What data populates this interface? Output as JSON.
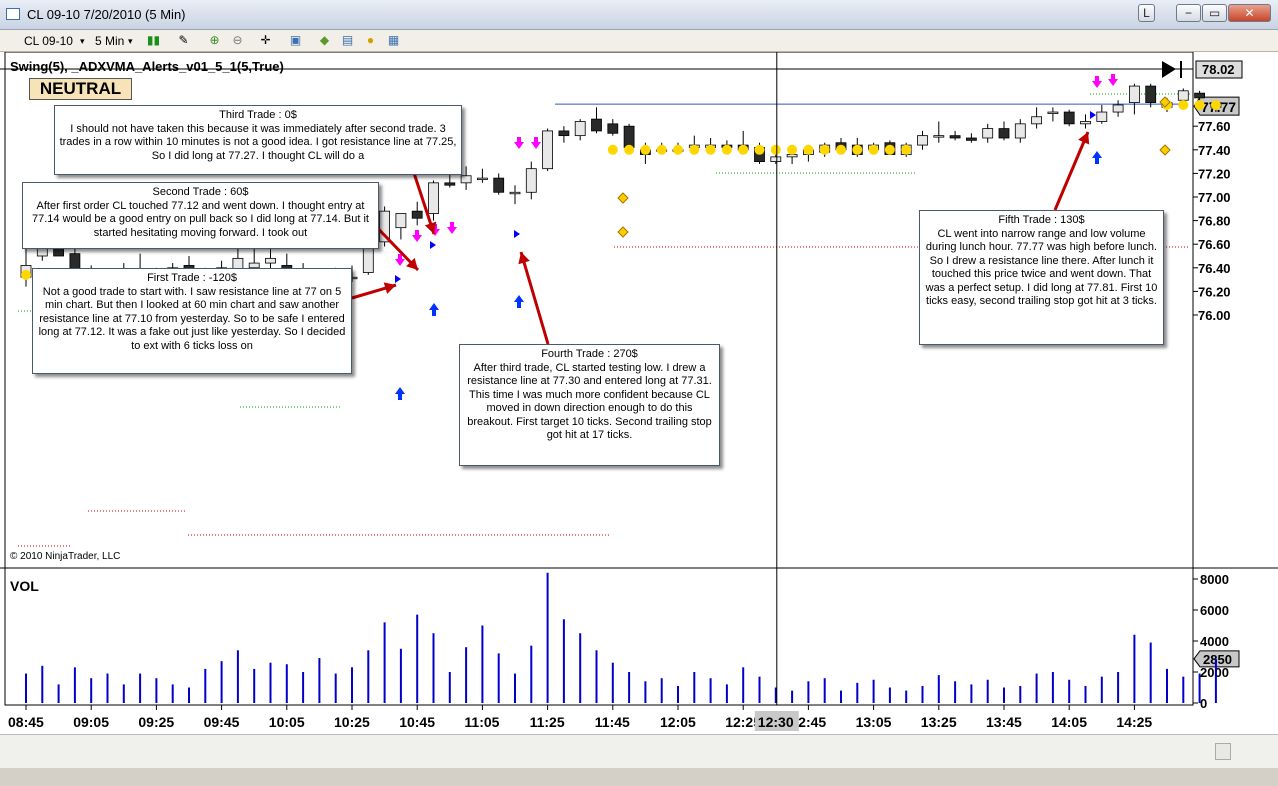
{
  "window": {
    "title": "CL 09-10  7/20/2010 (5 Min)",
    "btn_l": "L",
    "btn_min": "−",
    "btn_max": "▭",
    "btn_close": "✕"
  },
  "toolbar": {
    "instrument": "CL 09-10",
    "interval": "5 Min",
    "dropdown_glyph": "▾",
    "icons": [
      "candlestick-icon",
      "pencil-icon",
      "zoom-in-icon",
      "zoom-out-icon",
      "crosshair-icon",
      "properties-icon",
      "strategy-icon",
      "chart-trader-icon",
      "coin-icon",
      "data-box-icon"
    ]
  },
  "chart": {
    "indicator_label": "Swing(5),  _ADXVMA_Alerts_v01_5_1(5,True)",
    "state": "NEUTRAL",
    "copyright": "© 2010 NinjaTrader, LLC",
    "price_labels": [
      "78.02",
      "77.60",
      "77.40",
      "77.20",
      "77.00",
      "76.80",
      "76.60",
      "76.40",
      "76.20",
      "76.00"
    ],
    "price_ticks": [
      77.6,
      77.4,
      77.2,
      77.0,
      76.8,
      76.6,
      76.4,
      76.2,
      76.0
    ],
    "top_marker": "78.02",
    "last_price": "77.77",
    "volume_label": "VOL",
    "volume_ticks": [
      "8000",
      "6000",
      "4000",
      "2000",
      "0"
    ],
    "last_volume": "2850",
    "time_labels": [
      "08:45",
      "09:05",
      "09:25",
      "09:45",
      "10:05",
      "10:25",
      "10:45",
      "11:05",
      "11:25",
      "11:45",
      "12:05",
      "12:25",
      "12:45",
      "13:05",
      "13:25",
      "13:45",
      "14:05",
      "14:25"
    ],
    "cursor_time": "12:30",
    "colors": {
      "up_candle": "#e8e8e8",
      "down_candle": "#2a2a2a",
      "adxvma": "#ffd700",
      "volume": "#0000cc",
      "resistance": "#3355cc",
      "arrow_note": "#c00000",
      "buy_arrow": "#0033ff",
      "signal": "#ff00ff"
    }
  },
  "notes": [
    {
      "title": "Third Trade : 0$",
      "body": "I should not have taken this because it was immediately after second trade. 3 trades in a row within 10 minutes is not a good idea. I got resistance line at 77.25, So I did long at 77.27. I thought CL will do a"
    },
    {
      "title": "Second Trade : 60$",
      "body": "After first order CL touched 77.12 and went down. I thought entry at 77.14 would be a good entry on pull back so I did long at 77.14. But it started hesitating moving forward. I took out"
    },
    {
      "title": "First Trade : -120$",
      "body": "Not a good trade to start with. I saw resistance line at 77 on 5 min chart. But then I looked at 60 min chart and saw another resistance line at 77.10 from yesterday. So to be safe I entered long at 77.12. It was a fake out just like yesterday. So I decided to ext with 6 ticks loss on"
    },
    {
      "title": "Fourth Trade : 270$",
      "body": "After third trade, CL started testing low. I drew a resistance line at 77.30 and entered long at 77.31. This time I was much more confident because CL moved in down direction enough to do this breakout. First target 10 ticks. Second trailing stop got hit at 17 ticks."
    },
    {
      "title": "Fifth Trade : 130$",
      "body": "CL went into narrow range and low volume during lunch hour. 77.77 was high before lunch. So I drew a resistance line there. After lunch it touched this price twice and went down. That was a perfect setup. I did long at 77.81. First 10 ticks easy, second trailing stop got hit at 3 ticks."
    }
  ],
  "chart_data": {
    "type": "candlestick",
    "ylim": [
      75.98,
      78.06
    ],
    "candles": [
      {
        "o": 76.32,
        "h": 76.62,
        "l": 76.24,
        "c": 76.42
      },
      {
        "o": 76.5,
        "h": 76.66,
        "l": 76.46,
        "c": 76.64
      },
      {
        "o": 76.64,
        "h": 76.64,
        "l": 76.5,
        "c": 76.5
      },
      {
        "o": 76.52,
        "h": 76.56,
        "l": 76.3,
        "c": 76.38
      },
      {
        "o": 76.36,
        "h": 76.42,
        "l": 76.2,
        "c": 76.32
      },
      {
        "o": 76.3,
        "h": 76.38,
        "l": 76.28,
        "c": 76.34
      },
      {
        "o": 76.32,
        "h": 76.44,
        "l": 76.3,
        "c": 76.38
      },
      {
        "o": 76.38,
        "h": 76.52,
        "l": 76.3,
        "c": 76.32
      },
      {
        "o": 76.36,
        "h": 76.4,
        "l": 76.3,
        "c": 76.32
      },
      {
        "o": 76.4,
        "h": 76.44,
        "l": 76.28,
        "c": 76.36
      },
      {
        "o": 76.42,
        "h": 76.5,
        "l": 76.22,
        "c": 76.22
      },
      {
        "o": 76.38,
        "h": 76.4,
        "l": 76.06,
        "c": 76.28
      },
      {
        "o": 76.4,
        "h": 76.46,
        "l": 76.22,
        "c": 76.24
      },
      {
        "o": 76.26,
        "h": 76.56,
        "l": 76.22,
        "c": 76.48
      },
      {
        "o": 76.4,
        "h": 76.58,
        "l": 76.38,
        "c": 76.44
      },
      {
        "o": 76.44,
        "h": 76.56,
        "l": 76.36,
        "c": 76.48
      },
      {
        "o": 76.42,
        "h": 76.52,
        "l": 76.32,
        "c": 76.38
      },
      {
        "o": 76.38,
        "h": 76.44,
        "l": 76.26,
        "c": 76.28
      },
      {
        "o": 76.26,
        "h": 76.38,
        "l": 76.24,
        "c": 76.32
      },
      {
        "o": 76.28,
        "h": 76.4,
        "l": 76.26,
        "c": 76.36
      },
      {
        "o": 76.32,
        "h": 76.42,
        "l": 76.28,
        "c": 76.32
      },
      {
        "o": 76.36,
        "h": 76.64,
        "l": 76.34,
        "c": 76.62
      },
      {
        "o": 76.62,
        "h": 76.92,
        "l": 76.58,
        "c": 76.88
      },
      {
        "o": 76.74,
        "h": 76.86,
        "l": 76.64,
        "c": 76.86
      },
      {
        "o": 76.88,
        "h": 76.96,
        "l": 76.76,
        "c": 76.82
      },
      {
        "o": 76.86,
        "h": 77.14,
        "l": 76.8,
        "c": 77.12
      },
      {
        "o": 77.12,
        "h": 77.22,
        "l": 77.08,
        "c": 77.1
      },
      {
        "o": 77.12,
        "h": 77.26,
        "l": 77.06,
        "c": 77.18
      },
      {
        "o": 77.16,
        "h": 77.24,
        "l": 77.12,
        "c": 77.16
      },
      {
        "o": 77.16,
        "h": 77.2,
        "l": 77.02,
        "c": 77.04
      },
      {
        "o": 77.04,
        "h": 77.1,
        "l": 76.94,
        "c": 77.04
      },
      {
        "o": 77.04,
        "h": 77.3,
        "l": 76.98,
        "c": 77.24
      },
      {
        "o": 77.24,
        "h": 77.58,
        "l": 77.22,
        "c": 77.56
      },
      {
        "o": 77.56,
        "h": 77.6,
        "l": 77.46,
        "c": 77.52
      },
      {
        "o": 77.52,
        "h": 77.66,
        "l": 77.48,
        "c": 77.64
      },
      {
        "o": 77.66,
        "h": 77.76,
        "l": 77.54,
        "c": 77.56
      },
      {
        "o": 77.62,
        "h": 77.66,
        "l": 77.52,
        "c": 77.54
      },
      {
        "o": 77.6,
        "h": 77.62,
        "l": 77.4,
        "c": 77.42
      },
      {
        "o": 77.4,
        "h": 77.46,
        "l": 77.28,
        "c": 77.36
      },
      {
        "o": 77.4,
        "h": 77.46,
        "l": 77.36,
        "c": 77.4
      },
      {
        "o": 77.4,
        "h": 77.46,
        "l": 77.36,
        "c": 77.4
      },
      {
        "o": 77.42,
        "h": 77.52,
        "l": 77.38,
        "c": 77.44
      },
      {
        "o": 77.42,
        "h": 77.5,
        "l": 77.4,
        "c": 77.44
      },
      {
        "o": 77.44,
        "h": 77.48,
        "l": 77.38,
        "c": 77.42
      },
      {
        "o": 77.44,
        "h": 77.56,
        "l": 77.4,
        "c": 77.4
      },
      {
        "o": 77.42,
        "h": 77.46,
        "l": 77.28,
        "c": 77.3
      },
      {
        "o": 77.3,
        "h": 77.36,
        "l": 77.28,
        "c": 77.34
      },
      {
        "o": 77.34,
        "h": 77.42,
        "l": 77.28,
        "c": 77.36
      },
      {
        "o": 77.36,
        "h": 77.4,
        "l": 77.3,
        "c": 77.4
      },
      {
        "o": 77.38,
        "h": 77.46,
        "l": 77.34,
        "c": 77.44
      },
      {
        "o": 77.46,
        "h": 77.5,
        "l": 77.38,
        "c": 77.4
      },
      {
        "o": 77.44,
        "h": 77.5,
        "l": 77.34,
        "c": 77.36
      },
      {
        "o": 77.4,
        "h": 77.46,
        "l": 77.38,
        "c": 77.44
      },
      {
        "o": 77.46,
        "h": 77.48,
        "l": 77.36,
        "c": 77.36
      },
      {
        "o": 77.36,
        "h": 77.46,
        "l": 77.34,
        "c": 77.44
      },
      {
        "o": 77.44,
        "h": 77.56,
        "l": 77.4,
        "c": 77.52
      },
      {
        "o": 77.52,
        "h": 77.64,
        "l": 77.46,
        "c": 77.52
      },
      {
        "o": 77.52,
        "h": 77.56,
        "l": 77.48,
        "c": 77.5
      },
      {
        "o": 77.5,
        "h": 77.54,
        "l": 77.46,
        "c": 77.48
      },
      {
        "o": 77.5,
        "h": 77.62,
        "l": 77.46,
        "c": 77.58
      },
      {
        "o": 77.58,
        "h": 77.64,
        "l": 77.48,
        "c": 77.5
      },
      {
        "o": 77.5,
        "h": 77.66,
        "l": 77.46,
        "c": 77.62
      },
      {
        "o": 77.62,
        "h": 77.76,
        "l": 77.58,
        "c": 77.68
      },
      {
        "o": 77.72,
        "h": 77.76,
        "l": 77.64,
        "c": 77.72
      },
      {
        "o": 77.72,
        "h": 77.74,
        "l": 77.6,
        "c": 77.62
      },
      {
        "o": 77.62,
        "h": 77.7,
        "l": 77.58,
        "c": 77.64
      },
      {
        "o": 77.64,
        "h": 77.78,
        "l": 77.62,
        "c": 77.72
      },
      {
        "o": 77.72,
        "h": 77.82,
        "l": 77.68,
        "c": 77.78
      },
      {
        "o": 77.8,
        "h": 77.96,
        "l": 77.7,
        "c": 77.94
      },
      {
        "o": 77.94,
        "h": 77.96,
        "l": 77.76,
        "c": 77.8
      },
      {
        "o": 77.76,
        "h": 77.84,
        "l": 77.72,
        "c": 77.8
      },
      {
        "o": 77.82,
        "h": 77.92,
        "l": 77.8,
        "c": 77.9
      },
      {
        "o": 77.88,
        "h": 77.9,
        "l": 77.76,
        "c": 77.84
      },
      {
        "o": 77.8,
        "h": 77.82,
        "l": 77.72,
        "c": 77.76
      }
    ],
    "adxvma": [
      76.34,
      76.34,
      76.34,
      76.34,
      76.34,
      76.34,
      76.34,
      76.34,
      76.34,
      76.34,
      76.34,
      76.34,
      76.34,
      76.34,
      76.34,
      76.34,
      76.34,
      76.34,
      null,
      null,
      null,
      null,
      null,
      null,
      null,
      null,
      null,
      null,
      null,
      null,
      null,
      null,
      null,
      null,
      null,
      null,
      77.4,
      77.4,
      77.4,
      77.4,
      77.4,
      77.4,
      77.4,
      77.4,
      77.4,
      77.4,
      77.4,
      77.4,
      77.4,
      77.4,
      77.4,
      77.4,
      77.4,
      77.4,
      77.4,
      null,
      null,
      null,
      null,
      null,
      null,
      null,
      null,
      null,
      null,
      null,
      null,
      null,
      null,
      null,
      77.78,
      77.78,
      77.78,
      77.78
    ],
    "volume": [
      1900,
      2400,
      1200,
      2300,
      1600,
      1900,
      1200,
      1900,
      1600,
      1200,
      1000,
      2200,
      2700,
      3400,
      2200,
      2600,
      2500,
      2000,
      2900,
      1900,
      2300,
      3400,
      5200,
      3500,
      5700,
      4500,
      2000,
      3600,
      5000,
      3200,
      1900,
      3700,
      8400,
      5400,
      4500,
      3400,
      2600,
      2000,
      1400,
      1600,
      1100,
      2000,
      1600,
      1200,
      2300,
      1700,
      1000,
      800,
      1400,
      1600,
      800,
      1300,
      1500,
      1000,
      800,
      1100,
      1800,
      1400,
      1200,
      1500,
      1000,
      1100,
      1900,
      2000,
      1500,
      1100,
      1700,
      2000,
      4400,
      3900,
      2200,
      1700,
      1900,
      2850
    ],
    "resistance_line": 77.77,
    "cursor_candle": 46
  }
}
